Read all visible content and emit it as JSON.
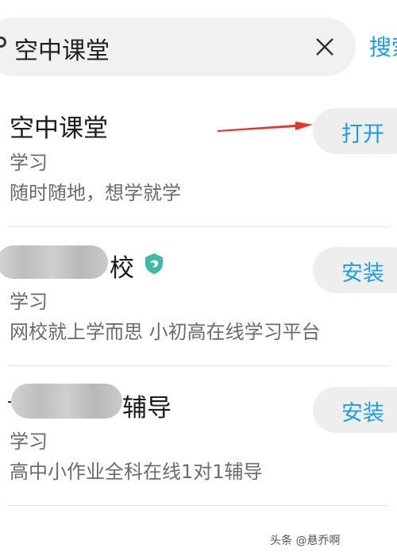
{
  "search": {
    "query": "空中课堂",
    "button_label": "搜索"
  },
  "results": [
    {
      "name": "空中课堂",
      "category": "学习",
      "description": "随时随地，想学就学",
      "action": "打开"
    },
    {
      "name_visible_suffix": "校",
      "category": "学习",
      "description": "网校就上学而思 小初高在线学习平台",
      "action": "安装"
    },
    {
      "name_visible_suffix": "辅导",
      "category": "学习",
      "description": "高中小作业全科在线1对1辅导",
      "action": "安装"
    }
  ],
  "watermark": "头条 @悬乔啊",
  "colors": {
    "accent": "#1a9ce8",
    "annotation_arrow": "#e8322b",
    "verified_badge": "#3fb8a6"
  },
  "icons": {
    "clear": "close-icon",
    "verified": "verified-badge-icon",
    "annotation": "red-arrow-icon"
  }
}
